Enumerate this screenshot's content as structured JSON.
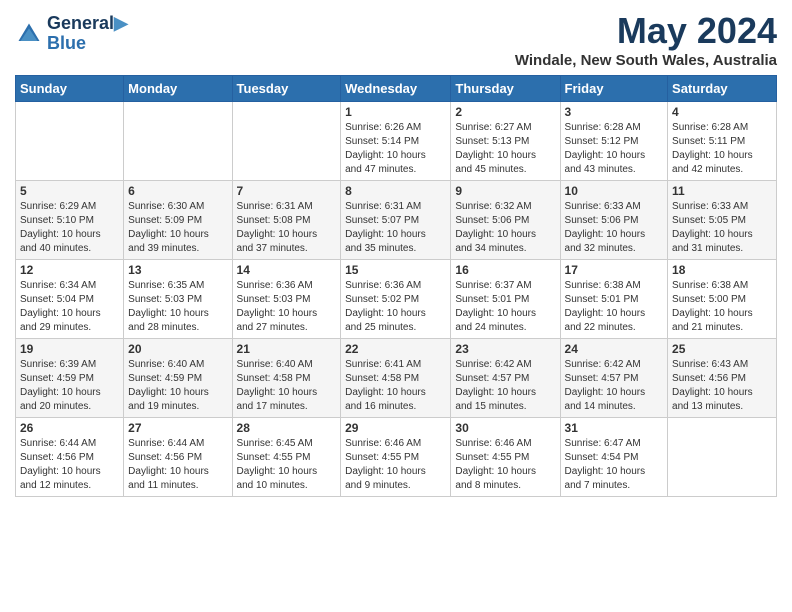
{
  "header": {
    "logo_line1": "General",
    "logo_line2": "Blue",
    "main_title": "May 2024",
    "subtitle": "Windale, New South Wales, Australia"
  },
  "weekdays": [
    "Sunday",
    "Monday",
    "Tuesday",
    "Wednesday",
    "Thursday",
    "Friday",
    "Saturday"
  ],
  "weeks": [
    [
      {
        "day": "",
        "info": ""
      },
      {
        "day": "",
        "info": ""
      },
      {
        "day": "",
        "info": ""
      },
      {
        "day": "1",
        "info": "Sunrise: 6:26 AM\nSunset: 5:14 PM\nDaylight: 10 hours\nand 47 minutes."
      },
      {
        "day": "2",
        "info": "Sunrise: 6:27 AM\nSunset: 5:13 PM\nDaylight: 10 hours\nand 45 minutes."
      },
      {
        "day": "3",
        "info": "Sunrise: 6:28 AM\nSunset: 5:12 PM\nDaylight: 10 hours\nand 43 minutes."
      },
      {
        "day": "4",
        "info": "Sunrise: 6:28 AM\nSunset: 5:11 PM\nDaylight: 10 hours\nand 42 minutes."
      }
    ],
    [
      {
        "day": "5",
        "info": "Sunrise: 6:29 AM\nSunset: 5:10 PM\nDaylight: 10 hours\nand 40 minutes."
      },
      {
        "day": "6",
        "info": "Sunrise: 6:30 AM\nSunset: 5:09 PM\nDaylight: 10 hours\nand 39 minutes."
      },
      {
        "day": "7",
        "info": "Sunrise: 6:31 AM\nSunset: 5:08 PM\nDaylight: 10 hours\nand 37 minutes."
      },
      {
        "day": "8",
        "info": "Sunrise: 6:31 AM\nSunset: 5:07 PM\nDaylight: 10 hours\nand 35 minutes."
      },
      {
        "day": "9",
        "info": "Sunrise: 6:32 AM\nSunset: 5:06 PM\nDaylight: 10 hours\nand 34 minutes."
      },
      {
        "day": "10",
        "info": "Sunrise: 6:33 AM\nSunset: 5:06 PM\nDaylight: 10 hours\nand 32 minutes."
      },
      {
        "day": "11",
        "info": "Sunrise: 6:33 AM\nSunset: 5:05 PM\nDaylight: 10 hours\nand 31 minutes."
      }
    ],
    [
      {
        "day": "12",
        "info": "Sunrise: 6:34 AM\nSunset: 5:04 PM\nDaylight: 10 hours\nand 29 minutes."
      },
      {
        "day": "13",
        "info": "Sunrise: 6:35 AM\nSunset: 5:03 PM\nDaylight: 10 hours\nand 28 minutes."
      },
      {
        "day": "14",
        "info": "Sunrise: 6:36 AM\nSunset: 5:03 PM\nDaylight: 10 hours\nand 27 minutes."
      },
      {
        "day": "15",
        "info": "Sunrise: 6:36 AM\nSunset: 5:02 PM\nDaylight: 10 hours\nand 25 minutes."
      },
      {
        "day": "16",
        "info": "Sunrise: 6:37 AM\nSunset: 5:01 PM\nDaylight: 10 hours\nand 24 minutes."
      },
      {
        "day": "17",
        "info": "Sunrise: 6:38 AM\nSunset: 5:01 PM\nDaylight: 10 hours\nand 22 minutes."
      },
      {
        "day": "18",
        "info": "Sunrise: 6:38 AM\nSunset: 5:00 PM\nDaylight: 10 hours\nand 21 minutes."
      }
    ],
    [
      {
        "day": "19",
        "info": "Sunrise: 6:39 AM\nSunset: 4:59 PM\nDaylight: 10 hours\nand 20 minutes."
      },
      {
        "day": "20",
        "info": "Sunrise: 6:40 AM\nSunset: 4:59 PM\nDaylight: 10 hours\nand 19 minutes."
      },
      {
        "day": "21",
        "info": "Sunrise: 6:40 AM\nSunset: 4:58 PM\nDaylight: 10 hours\nand 17 minutes."
      },
      {
        "day": "22",
        "info": "Sunrise: 6:41 AM\nSunset: 4:58 PM\nDaylight: 10 hours\nand 16 minutes."
      },
      {
        "day": "23",
        "info": "Sunrise: 6:42 AM\nSunset: 4:57 PM\nDaylight: 10 hours\nand 15 minutes."
      },
      {
        "day": "24",
        "info": "Sunrise: 6:42 AM\nSunset: 4:57 PM\nDaylight: 10 hours\nand 14 minutes."
      },
      {
        "day": "25",
        "info": "Sunrise: 6:43 AM\nSunset: 4:56 PM\nDaylight: 10 hours\nand 13 minutes."
      }
    ],
    [
      {
        "day": "26",
        "info": "Sunrise: 6:44 AM\nSunset: 4:56 PM\nDaylight: 10 hours\nand 12 minutes."
      },
      {
        "day": "27",
        "info": "Sunrise: 6:44 AM\nSunset: 4:56 PM\nDaylight: 10 hours\nand 11 minutes."
      },
      {
        "day": "28",
        "info": "Sunrise: 6:45 AM\nSunset: 4:55 PM\nDaylight: 10 hours\nand 10 minutes."
      },
      {
        "day": "29",
        "info": "Sunrise: 6:46 AM\nSunset: 4:55 PM\nDaylight: 10 hours\nand 9 minutes."
      },
      {
        "day": "30",
        "info": "Sunrise: 6:46 AM\nSunset: 4:55 PM\nDaylight: 10 hours\nand 8 minutes."
      },
      {
        "day": "31",
        "info": "Sunrise: 6:47 AM\nSunset: 4:54 PM\nDaylight: 10 hours\nand 7 minutes."
      },
      {
        "day": "",
        "info": ""
      }
    ]
  ]
}
